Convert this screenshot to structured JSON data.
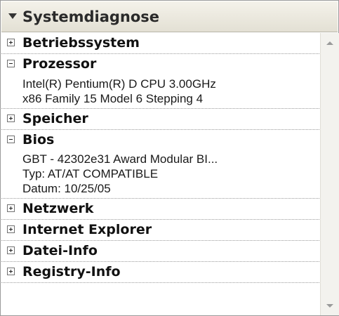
{
  "header": {
    "title": "Systemdiagnose",
    "icon": "collapse-arrow-icon"
  },
  "sections": {
    "betriebssystem": {
      "label": "Betriebssystem",
      "state": "collapsed"
    },
    "prozessor": {
      "label": "Prozessor",
      "state": "expanded",
      "lines": [
        "Intel(R) Pentium(R) D CPU 3.00GHz",
        "x86 Family 15 Model 6 Stepping 4"
      ]
    },
    "speicher": {
      "label": "Speicher",
      "state": "collapsed"
    },
    "bios": {
      "label": "Bios",
      "state": "expanded",
      "lines": [
        "GBT   - 42302e31 Award Modular BI...",
        "Typ:  AT/AT COMPATIBLE",
        "Datum:  10/25/05"
      ]
    },
    "netzwerk": {
      "label": "Netzwerk",
      "state": "collapsed"
    },
    "internet_explorer": {
      "label": "Internet Explorer",
      "state": "collapsed"
    },
    "datei_info": {
      "label": "Datei-Info",
      "state": "collapsed"
    },
    "registry_info": {
      "label": "Registry-Info",
      "state": "collapsed"
    }
  },
  "colors": {
    "header_bg": "#ebe8dc",
    "text": "#111111",
    "divider": "#9a9a9a"
  }
}
